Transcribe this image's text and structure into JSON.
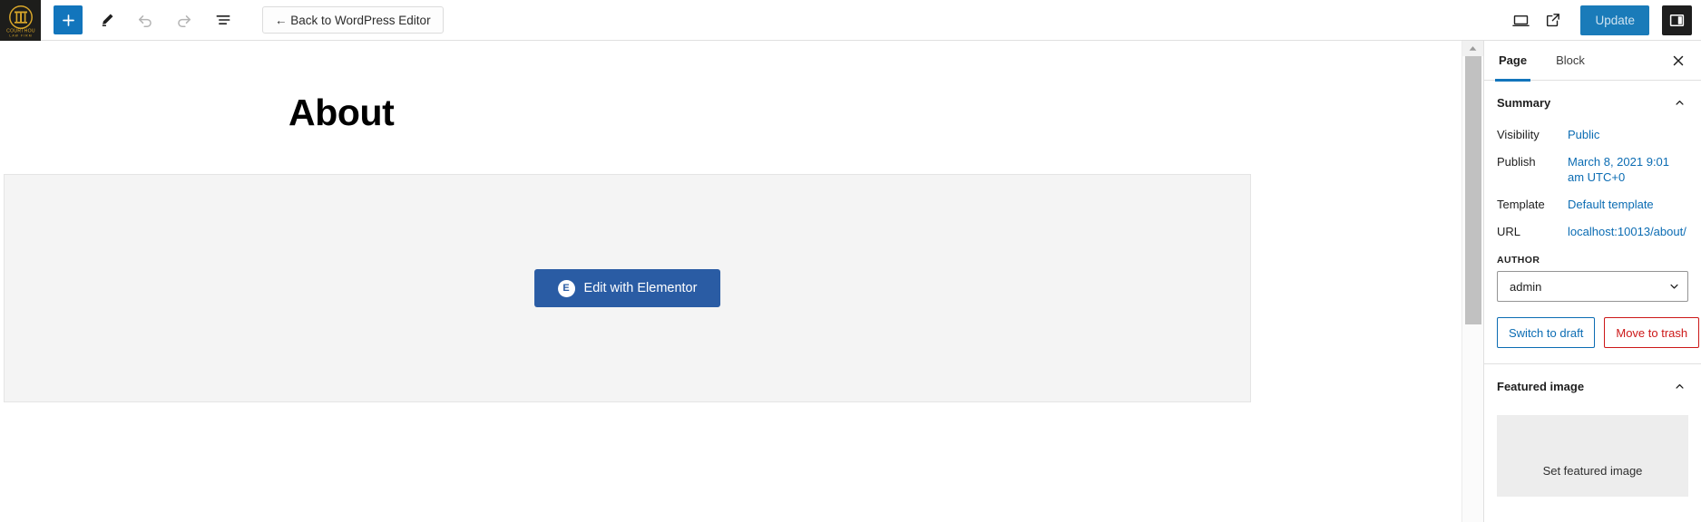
{
  "header": {
    "logo": {
      "name": "courthouse-law-logo",
      "text": "COURTHOUSE",
      "subtext": "LAW FIRM",
      "color": "#d8a62a",
      "bg": "#1d1d1b"
    },
    "tools": [
      {
        "name": "add-block-button",
        "icon": "plus-icon",
        "label": "Add block",
        "state": "primary"
      },
      {
        "name": "tools-button",
        "icon": "pencil-icon",
        "label": "Tools",
        "state": "default"
      },
      {
        "name": "undo-button",
        "icon": "undo-icon",
        "label": "Undo",
        "state": "disabled"
      },
      {
        "name": "redo-button",
        "icon": "redo-icon",
        "label": "Redo",
        "state": "disabled"
      },
      {
        "name": "list-view-button",
        "icon": "list-view-icon",
        "label": "List view",
        "state": "default"
      }
    ],
    "back_button": "← Back to WordPress Editor",
    "preview_label": "Preview",
    "view_label": "View page",
    "update_label": "Update",
    "settings_label": "Settings"
  },
  "canvas": {
    "post_title": "About",
    "elementor_button": "Edit with Elementor",
    "elementor_logo_letter": "E"
  },
  "sidebar": {
    "tabs": [
      {
        "label": "Page",
        "active": true
      },
      {
        "label": "Block",
        "active": false
      }
    ],
    "close_label": "Close settings",
    "summary": {
      "title": "Summary",
      "rows": [
        {
          "label": "Visibility",
          "value": "Public"
        },
        {
          "label": "Publish",
          "value": "March 8, 2021 9:01 am UTC+0"
        },
        {
          "label": "Template",
          "value": "Default template"
        },
        {
          "label": "URL",
          "value": "localhost:10013/about/"
        }
      ],
      "author_label": "AUTHOR",
      "author_value": "admin",
      "switch_to_draft": "Switch to draft",
      "move_to_trash": "Move to trash"
    },
    "featured_image": {
      "title": "Featured image",
      "placeholder": "Set featured image"
    }
  },
  "colors": {
    "accent_blue": "#1275bc",
    "link_blue": "#0b6cb3",
    "update_blue": "#1a7bb9",
    "elementor_blue": "#2a5ca4",
    "danger_red": "#cc1818",
    "logo_gold": "#d8a62a"
  }
}
